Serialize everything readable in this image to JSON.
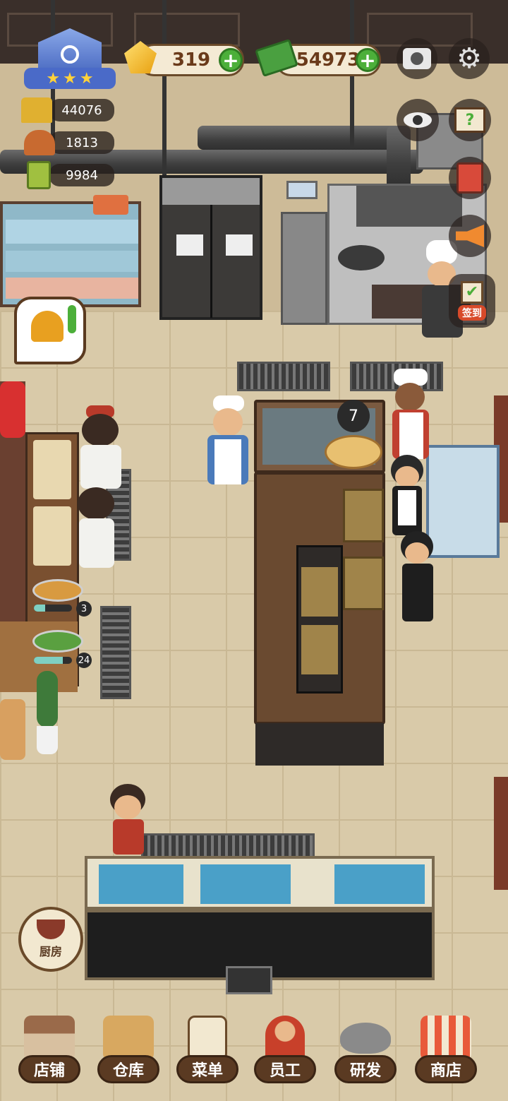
{
  "rank": {
    "stars": 3
  },
  "currency": {
    "gems": "319",
    "cash": "54973"
  },
  "stats": [
    {
      "icon": "golden-ding-icon",
      "value": "44076"
    },
    {
      "icon": "serving-cloche-icon",
      "value": "1813"
    },
    {
      "icon": "recipe-book-icon",
      "value": "9984"
    }
  ],
  "side_buttons": {
    "checkin_label": "签到"
  },
  "kitchen": {
    "wok_badge": "7",
    "prep_counts": [
      "3",
      "24"
    ],
    "prep_progress": [
      0.3,
      0.75
    ],
    "kitchen_button_label": "厨房"
  },
  "bottom_nav": [
    {
      "label": "店铺",
      "icon": "storefront-icon"
    },
    {
      "label": "仓库",
      "icon": "warehouse-boxes-icon"
    },
    {
      "label": "菜单",
      "icon": "menu-clipboard-icon"
    },
    {
      "label": "员工",
      "icon": "staff-icon"
    },
    {
      "label": "研发",
      "icon": "research-wok-icon"
    },
    {
      "label": "商店",
      "icon": "shop-icon"
    }
  ],
  "colors": {
    "accent_green": "#4caf3a",
    "nav_brown": "#5a3a22",
    "floor": "#d9caa9"
  }
}
